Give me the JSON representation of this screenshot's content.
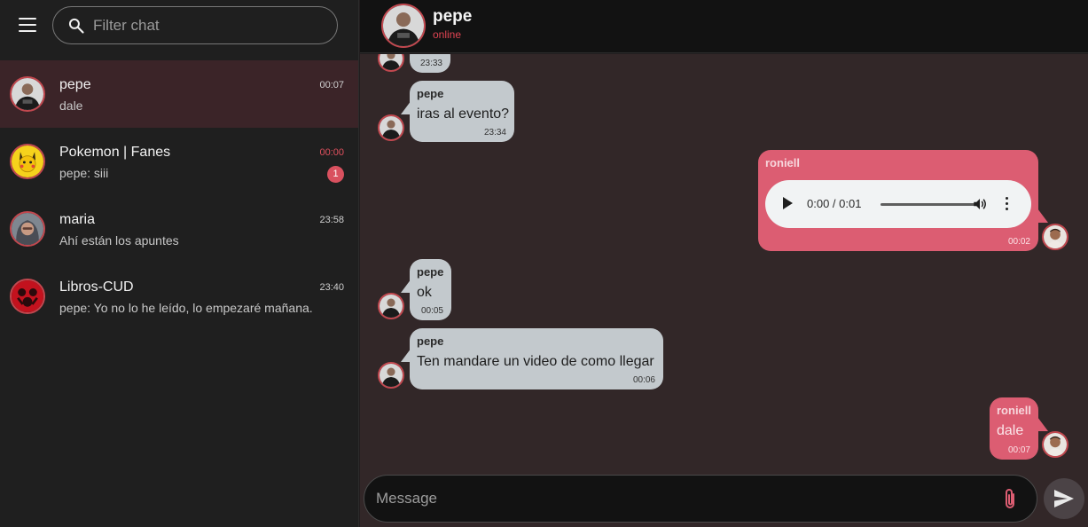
{
  "sidebar": {
    "search": {
      "placeholder": "Filter chat"
    },
    "chats": [
      {
        "name": "pepe",
        "preview": "dale",
        "time": "00:07",
        "active": true,
        "unread": ""
      },
      {
        "name": "Pokemon | Fanes",
        "preview": "pepe: siii",
        "time": "00:00",
        "active": false,
        "unread": "1"
      },
      {
        "name": "maria",
        "preview": "Ahí están los apuntes",
        "time": "23:58",
        "active": false,
        "unread": ""
      },
      {
        "name": "Libros-CUD",
        "preview": "pepe: Yo no lo he leído, lo empezaré mañana.",
        "time": "23:40",
        "active": false,
        "unread": ""
      }
    ]
  },
  "header": {
    "name": "pepe",
    "status": "online"
  },
  "messages": [
    {
      "direction": "in",
      "sender": "",
      "text": "",
      "time": "23:33"
    },
    {
      "direction": "in",
      "sender": "pepe",
      "text": "iras al evento?",
      "time": "23:34"
    },
    {
      "direction": "out",
      "sender": "roniell",
      "audio": {
        "time": "0:00 / 0:01"
      },
      "time": "00:02"
    },
    {
      "direction": "in",
      "sender": "pepe",
      "text": "ok",
      "time": "00:05"
    },
    {
      "direction": "in",
      "sender": "pepe",
      "text": "Ten mandare un video de como llegar",
      "time": "00:06"
    },
    {
      "direction": "out",
      "sender": "roniell",
      "text": "dale",
      "time": "00:07"
    }
  ],
  "composer": {
    "placeholder": "Message"
  },
  "icons": {
    "menu": "menu-icon",
    "search": "search-icon",
    "attach": "paperclip-icon",
    "send": "send-icon",
    "play": "play-icon",
    "volume": "volume-icon",
    "more": "more-vert-icon"
  },
  "colors": {
    "accent": "#dc5d72",
    "incoming_bubble": "#c3c9cd",
    "active_chat": "#3b2428",
    "status_online": "#e04452",
    "chat_background": "#322728"
  }
}
